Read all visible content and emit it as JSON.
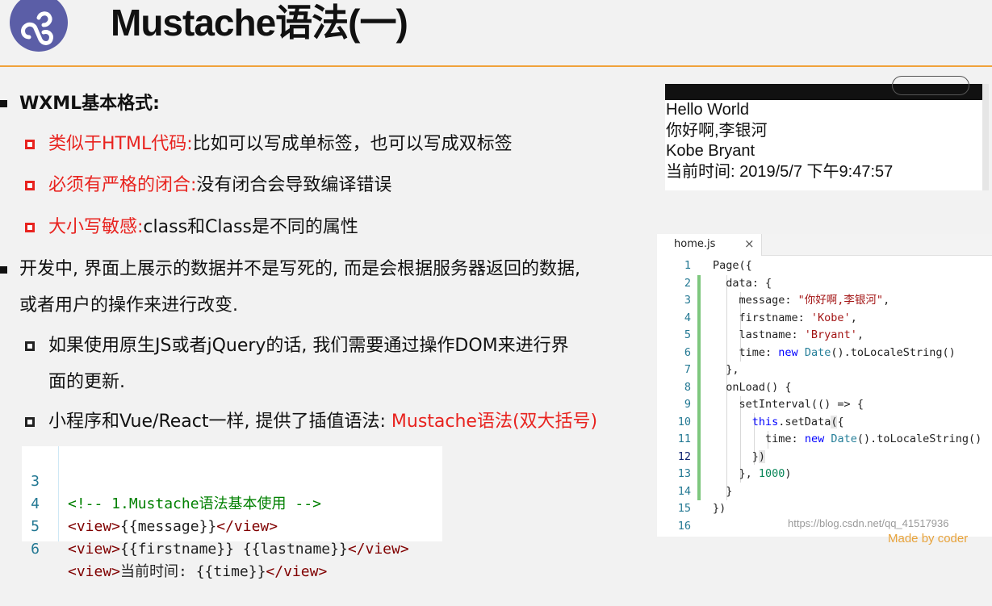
{
  "slide": {
    "title": "Mustache语法(一)",
    "bullets": {
      "wxml_format": "WXML基本格式:",
      "sub1_red": "类似于HTML代码:",
      "sub1_black": "比如可以写成单标签，也可以写成双标签",
      "sub2_red": "必须有严格的闭合:",
      "sub2_black": "没有闭合会导致编译错误",
      "sub3_red": "大小写敏感:",
      "sub3_black": "class和Class是不同的属性",
      "dev_line1": "开发中, 界面上展示的数据并不是写死的, 而是会根据服务器返回的数据,",
      "dev_line2": "或者用户的操作来进行改变.",
      "dom_line1": "如果使用原生JS或者jQuery的话, 我们需要通过操作DOM来进行界",
      "dom_line2": "面的更新.",
      "mustache_black": "小程序和Vue/React一样, 提供了插值语法:",
      "mustache_red": "Mustache语法(双大括号)"
    }
  },
  "preview": {
    "lines": [
      "Hello World",
      "你好啊,李银河",
      "Kobe Bryant",
      "当前时间: 2019/5/7 下午9:47:57"
    ]
  },
  "editor": {
    "tab": "home.js",
    "close": "×",
    "line_numbers": [
      "1",
      "2",
      "3",
      "4",
      "5",
      "6",
      "7",
      "8",
      "9",
      "10",
      "11",
      "12",
      "13",
      "14",
      "15",
      "16"
    ],
    "code": {
      "l1": "Page({",
      "l2": "data: {",
      "l3_key": "message: ",
      "l3_val": "\"你好啊,李银河\"",
      "l4_key": "firstname: ",
      "l4_val": "'Kobe'",
      "l5_key": "lastname: ",
      "l5_val": "'Bryant'",
      "l6_key": "time: ",
      "l6_new": "new",
      "l6_date": "Date",
      "l6_rest": "().toLocaleString()",
      "l7": "},",
      "l8": "onLoad() {",
      "l9": "setInterval(() => {",
      "l10_this": "this",
      "l10_rest": ".setData",
      "l10_paren": "(",
      "l10_brace": "{",
      "l11_key": "time: ",
      "l11_new": "new",
      "l11_date": "Date",
      "l11_rest": "().toLocaleString()",
      "l12_brace": "}",
      "l12_paren": ")",
      "l13_a": "}, ",
      "l13_num": "1000",
      "l13_b": ")",
      "l14": "}",
      "l15": "})"
    }
  },
  "wxml": {
    "line_numbers": [
      "3",
      "4",
      "5",
      "6"
    ],
    "comment": "<!-- 1.Mustache语法基本使用 -->",
    "view_open": "<view>",
    "view_close": "</view>",
    "m_message": "{{message}}",
    "m_firstname": "{{firstname}}",
    "m_lastname": "{{lastname}}",
    "l6_text": "当前时间: ",
    "m_time": "{{time}}"
  },
  "watermark": "https://blog.csdn.net/qq_41517936",
  "made_by": "Made by coder"
}
